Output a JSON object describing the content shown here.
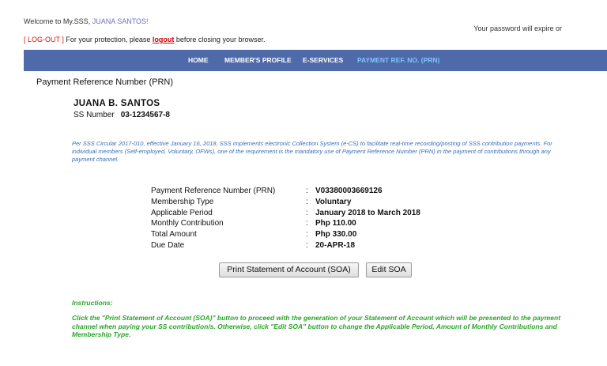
{
  "header": {
    "welcome_prefix": "Welcome to My.SSS, ",
    "user_name": "JUANA SANTOS!",
    "password_note": "Your password will expire or",
    "logout_label": "[ LOG-OUT ]",
    "protection_prefix": " For your protection, please ",
    "logout_link": "logout",
    "protection_suffix": " before closing your browser."
  },
  "nav": {
    "items": [
      {
        "label": "HOME"
      },
      {
        "label": "MEMBER'S PROFILE"
      },
      {
        "label": "E-SERVICES"
      },
      {
        "label": "PAYMENT REF. NO. (PRN)"
      }
    ],
    "active_color": "#7fc4ff",
    "bar_color": "#4f6aa8"
  },
  "page": {
    "title": "Payment Reference Number (PRN)"
  },
  "member": {
    "name": "JUANA B. SANTOS",
    "ss_label": "SS Number",
    "ss_number": "03-1234567-8"
  },
  "circular_text": "Per SSS Circular 2017-010, effective January 16, 2018, SSS implements electronic Collection System (e-CS) to facilitate real-time recording/posting of SSS contribution payments. For individual members (Self-employed, Voluntary, OFWs), one of the requirement is the mandatory use of Payment Reference Number (PRN) in the payment of contributions through any payment channel.",
  "details": [
    {
      "label": "Payment Reference Number (PRN)",
      "sep": ":",
      "value": "V03380003669126"
    },
    {
      "label": "Membership Type",
      "sep": ":",
      "value": "Voluntary"
    },
    {
      "label": "Applicable Period",
      "sep": ":",
      "value": "January 2018 to March 2018"
    },
    {
      "label": "Monthly Contribution",
      "sep": ":",
      "value": "Php 110.00"
    },
    {
      "label": "Total Amount",
      "sep": ":",
      "value": "Php 330.00"
    },
    {
      "label": "Due Date",
      "sep": ":",
      "value": "20-APR-18"
    }
  ],
  "buttons": {
    "print_soa": "Print Statement of Account (SOA)",
    "edit_soa": "Edit SOA"
  },
  "instructions": {
    "title": "Instructions:",
    "body": "Click the \"Print Statement of Account (SOA)\" button to proceed with the generation of your Statement of Account which will be presented to the payment channel when paying your SS contribution/s. Otherwise, click \"Edit SOA\" button to change the Applicable Period, Amount of Monthly Contributions and Membership Type."
  }
}
